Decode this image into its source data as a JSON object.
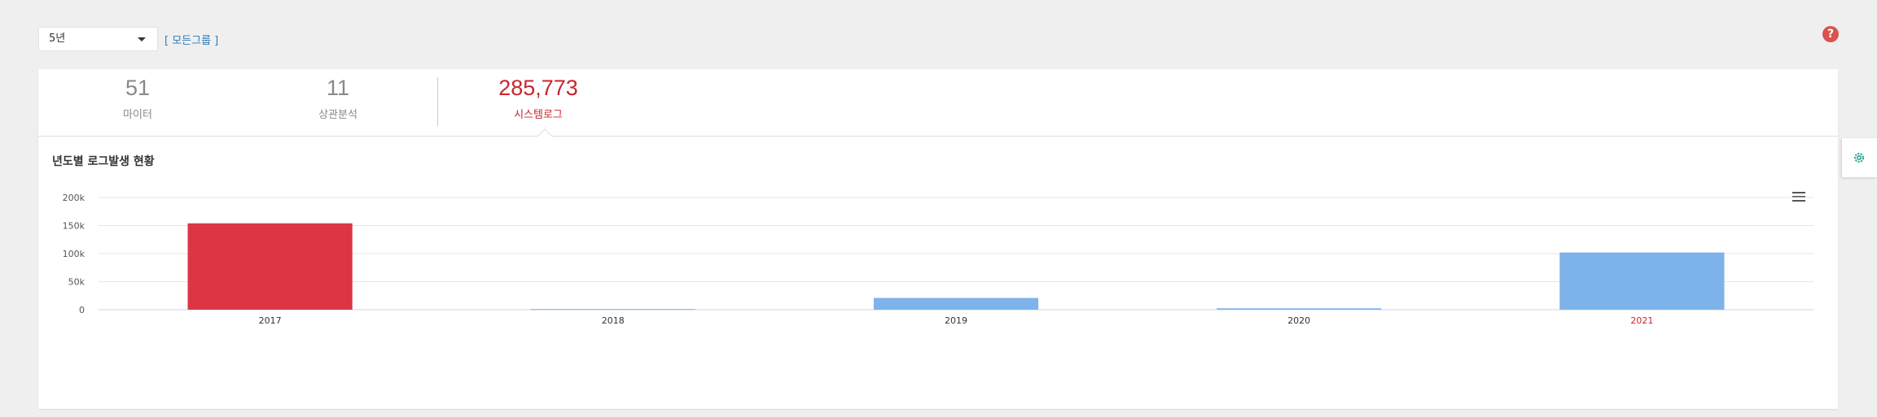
{
  "filter": {
    "period": "5년",
    "group_link": "[ 모든그룹 ]"
  },
  "help_icon": "?",
  "stats": [
    {
      "value": "51",
      "label": "마이터",
      "active": false
    },
    {
      "value": "11",
      "label": "상관분석",
      "active": false
    },
    {
      "value": "285,773",
      "label": "시스템로그",
      "active": true
    }
  ],
  "chart_title": "년도별 로그발생 현황",
  "colors": {
    "highlight": "#dc3545",
    "bar": "#7db3ea",
    "active_text": "#c9252c",
    "grid": "#e6e6e6"
  },
  "chart_data": {
    "type": "bar",
    "categories": [
      "2017",
      "2018",
      "2019",
      "2020",
      "2021"
    ],
    "values": [
      154000,
      1200,
      21000,
      2500,
      102000
    ],
    "highlight_index": 0,
    "highlight_label_index": 4,
    "yticks": [
      "0",
      "50k",
      "100k",
      "150k",
      "200k"
    ],
    "ylim": [
      0,
      200000
    ],
    "grid": true
  }
}
